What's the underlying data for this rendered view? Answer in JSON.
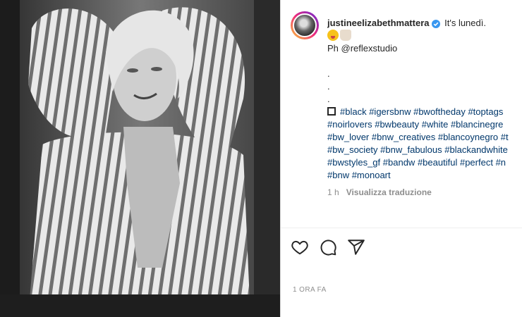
{
  "post": {
    "username": "justineelizabethmattera",
    "caption_first": "It's lunedì.",
    "credit": "Ph @reflexstudio",
    "dots": [
      ".",
      ".",
      "."
    ],
    "hashtag_lines": [
      [
        "#black",
        "#igersbnw",
        "#bwoftheday",
        "#toptags"
      ],
      [
        "#noirlovers",
        "#bwbeauty",
        "#white",
        "#blancinegre"
      ],
      [
        "#bw_lover",
        "#bnw_creatives",
        "#blancoynegro",
        "#t"
      ],
      [
        "#bw_society",
        "#bnw_fabulous",
        "#blackandwhite"
      ],
      [
        "#bwstyles_gf",
        "#bandw",
        "#beautiful",
        "#perfect",
        "#n"
      ],
      [
        "#bnw",
        "#monoart"
      ]
    ],
    "time_ago": "1 h",
    "translate_label": "Visualizza traduzione",
    "date_label": "1 ORA FA"
  },
  "icons": {
    "verified": "verified-badge-icon",
    "emoji_1": "zany-face-emoji-icon",
    "emoji_2": "coffee-cup-emoji-icon",
    "like": "heart-icon",
    "comment": "comment-icon",
    "share": "paper-plane-icon"
  },
  "colors": {
    "hashtag": "#00376b",
    "verified": "#3897f0",
    "muted": "#8e8e8e"
  }
}
